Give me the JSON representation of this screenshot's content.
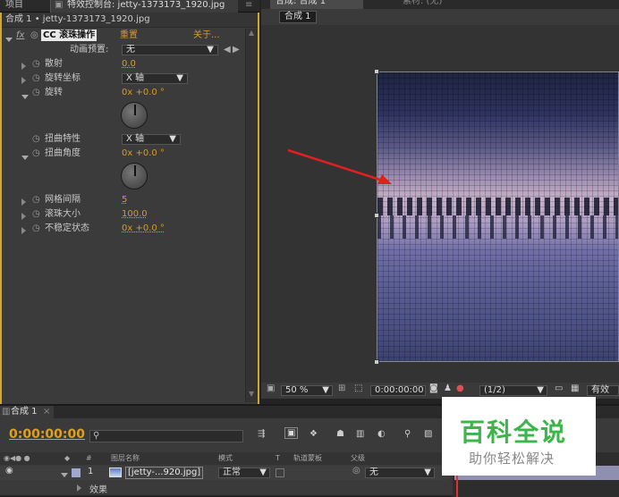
{
  "effects_panel": {
    "tab_project": "项目",
    "tab_effects_title": "特效控制台: jetty-1373173_1920.jpg",
    "breadcrumb": "合成 1 • jetty-1373173_1920.jpg",
    "effect_name": "CC 滚珠操作",
    "reset_label": "重置",
    "about_label": "关于...",
    "preset_label": "动画预置:",
    "preset_value": "无",
    "props": [
      {
        "name": "散射",
        "value": "0.0"
      },
      {
        "name": "旋转坐标",
        "value": "X 轴"
      },
      {
        "name": "旋转",
        "value": "0x +0.0 °"
      },
      {
        "name": "扭曲特性",
        "value": "X 轴"
      },
      {
        "name": "扭曲角度",
        "value": "0x +0.0 °"
      },
      {
        "name": "网格间隔",
        "value": "5"
      },
      {
        "name": "滚珠大小",
        "value": "100.0"
      },
      {
        "name": "不稳定状态",
        "value": "0x +0.0 °"
      }
    ]
  },
  "comp_panel": {
    "tab_title": "合成: 合成 1",
    "tab2": "素材: (无)",
    "sub_tab": "合成 1",
    "zoom": "50 %",
    "timecode": "0:00:00:00",
    "resolution": "(1/2)",
    "view_label": "有效"
  },
  "timeline": {
    "tab": "合成 1",
    "timecode": "0:00:00:00",
    "search_placeholder": "",
    "col_num": "#",
    "col_source": "图层名称",
    "col_mode": "模式",
    "col_t": "T",
    "col_trkmat": "轨道蒙板",
    "col_parent": "父级",
    "layer_num": "1",
    "layer_name": "[jetty-...920.jpg]",
    "layer_mode": "正常",
    "layer_parent": "无",
    "effects_label": "效果"
  },
  "watermark": {
    "title": "百科全说",
    "subtitle": "助你轻松解决"
  },
  "colors": {
    "accent_orange": "#d69a2c",
    "arrow_red": "#e02020",
    "watermark_green": "#3cb54a"
  }
}
